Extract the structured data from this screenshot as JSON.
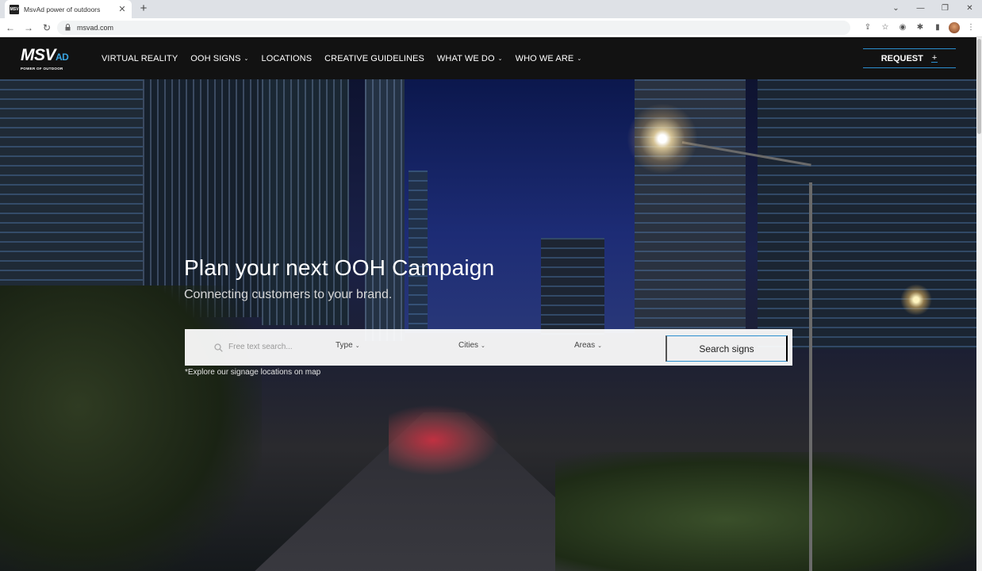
{
  "browser": {
    "tab_title": "MsvAd power of outdoors",
    "favicon_text": "MSV",
    "tab_close": "✕",
    "new_tab": "+",
    "url": "msvad.com",
    "window_controls": {
      "minimize_dropdown": "⌄",
      "minimize": "—",
      "restore": "❐",
      "close": "✕"
    },
    "nav": {
      "back": "←",
      "forward": "→",
      "reload": "↻"
    },
    "toolbar_icons": {
      "share": "⇪",
      "bookmark": "☆",
      "camera": "◉",
      "extensions": "✱",
      "sidepanel": "▮",
      "menu": "⋮"
    }
  },
  "site": {
    "logo": {
      "main": "MSV",
      "ad": "AD",
      "tagline": "POWER OF OUTDOOR"
    },
    "nav_items": [
      {
        "label": "VIRTUAL REALITY",
        "dropdown": false
      },
      {
        "label": "OOH SIGNS",
        "dropdown": true
      },
      {
        "label": "LOCATIONS",
        "dropdown": false
      },
      {
        "label": "CREATIVE GUIDELINES",
        "dropdown": false
      },
      {
        "label": "WHAT WE DO",
        "dropdown": true
      },
      {
        "label": "WHO WE ARE",
        "dropdown": true
      }
    ],
    "chevron": "⌄",
    "request": {
      "label": "REQUEST",
      "plus": "+"
    }
  },
  "hero": {
    "title": "Plan your next OOH Campaign",
    "subtitle": "Connecting customers to your brand.",
    "search": {
      "placeholder": "Free text search...",
      "type_label": "Type",
      "cities_label": "Cities",
      "areas_label": "Areas",
      "button_label": "Search signs"
    },
    "map_hint": "*Explore our signage locations on map"
  },
  "colors": {
    "accent": "#2b8fcf",
    "header_bg": "#121212",
    "logo_ad": "#3aa4e0"
  }
}
